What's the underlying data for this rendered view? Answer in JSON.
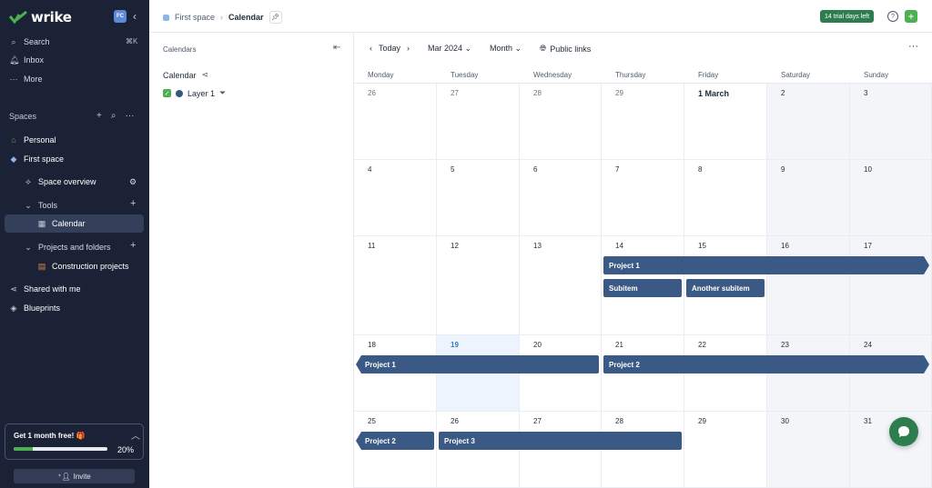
{
  "brand": {
    "name": "wrike",
    "avatar": "FC"
  },
  "sidebar": {
    "search_label": "Search",
    "search_shortcut": "⌘K",
    "inbox_label": "Inbox",
    "more_label": "More",
    "spaces_label": "Spaces",
    "personal_label": "Personal",
    "first_space_label": "First space",
    "space_overview_label": "Space overview",
    "tools_label": "Tools",
    "calendar_label": "Calendar",
    "projects_folders_label": "Projects and folders",
    "construction_label": "Construction projects",
    "shared_label": "Shared with me",
    "blueprints_label": "Blueprints",
    "promo": {
      "text": "Get 1 month free! 🎁",
      "percent_label": "20%",
      "progress": 0.2
    },
    "invite_label": "Invite"
  },
  "topbar": {
    "crumb_space": "First space",
    "crumb_page": "Calendar",
    "trial": "14 trial days left",
    "help": "?"
  },
  "calendars_panel": {
    "heading": "Calendars",
    "calendar_name": "Calendar",
    "layer_name": "Layer 1"
  },
  "toolbar": {
    "today": "Today",
    "month_year": "Mar 2024",
    "view": "Month",
    "public_links": "Public links"
  },
  "weekdays": [
    "Monday",
    "Tuesday",
    "Wednesday",
    "Thursday",
    "Friday",
    "Saturday",
    "Sunday"
  ],
  "weeks": [
    [
      "26",
      "27",
      "28",
      "29",
      "1 March",
      "2",
      "3"
    ],
    [
      "4",
      "5",
      "6",
      "7",
      "8",
      "9",
      "10"
    ],
    [
      "11",
      "12",
      "13",
      "14",
      "15",
      "16",
      "17"
    ],
    [
      "18",
      "19",
      "20",
      "21",
      "22",
      "23",
      "24"
    ],
    [
      "25",
      "26",
      "27",
      "28",
      "29",
      "30",
      "31"
    ]
  ],
  "events": [
    {
      "label": "Project 1",
      "week": 2,
      "start": 3,
      "end": 6,
      "lane": 0,
      "arrow_end": true
    },
    {
      "label": "Subitem",
      "week": 2,
      "start": 3,
      "end": 3,
      "lane": 1
    },
    {
      "label": "Another subitem",
      "week": 2,
      "start": 4,
      "end": 4,
      "lane": 1
    },
    {
      "label": "Project 1",
      "week": 3,
      "start": 0,
      "end": 2,
      "lane": 0,
      "arrow_start": true
    },
    {
      "label": "Project 2",
      "week": 3,
      "start": 3,
      "end": 6,
      "lane": 0,
      "arrow_end": true
    },
    {
      "label": "Project 2",
      "week": 4,
      "start": 0,
      "end": 0,
      "lane": 0,
      "arrow_start": true
    },
    {
      "label": "Project 3",
      "week": 4,
      "start": 1,
      "end": 3,
      "lane": 0
    }
  ]
}
